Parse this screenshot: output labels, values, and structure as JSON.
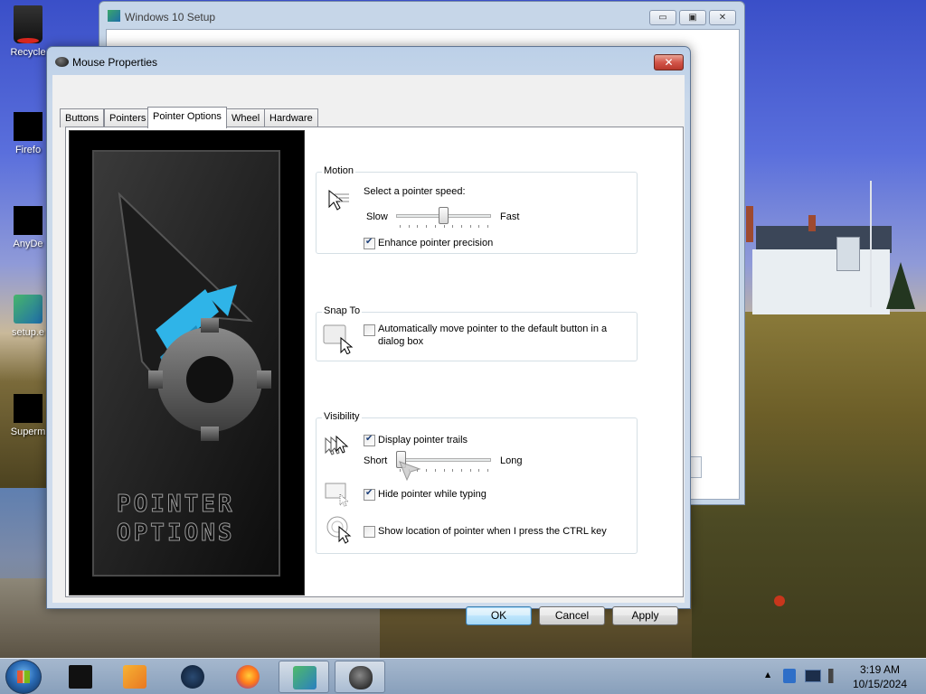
{
  "desktop": {
    "icons": [
      {
        "label": "Recycle"
      },
      {
        "label": "Firefo"
      },
      {
        "label": "AnyDe"
      },
      {
        "label": "setup.e"
      },
      {
        "label": "Superm"
      }
    ]
  },
  "background_window": {
    "title": "Windows 10 Setup",
    "minimize_glyph": "▭",
    "maximize_glyph": "▣",
    "close_glyph": "✕"
  },
  "dialog": {
    "title": "Mouse Properties",
    "close_glyph": "✕",
    "tabs": [
      {
        "label": "Buttons",
        "active": false
      },
      {
        "label": "Pointers",
        "active": false
      },
      {
        "label": "Pointer Options",
        "active": true
      },
      {
        "label": "Wheel",
        "active": false
      },
      {
        "label": "Hardware",
        "active": false
      }
    ],
    "art": {
      "line1": "POINTER",
      "line2": "OPTIONS"
    },
    "motion": {
      "title": "Motion",
      "speed_label": "Select a pointer speed:",
      "slow_label": "Slow",
      "fast_label": "Fast",
      "speed_position": 0.5,
      "enhance_label": "Enhance pointer precision",
      "enhance_checked": true
    },
    "snap_to": {
      "title": "Snap To",
      "auto_move_label_line1": "Automatically move pointer to the default button in a",
      "auto_move_label_line2": "dialog box",
      "auto_move_checked": false
    },
    "visibility": {
      "title": "Visibility",
      "trails_label": "Display pointer trails",
      "trails_checked": true,
      "short_label": "Short",
      "long_label": "Long",
      "trails_position": 0.0,
      "hide_typing_label": "Hide pointer while typing",
      "hide_typing_checked": true,
      "ctrl_location_label": "Show location of pointer when I press the CTRL key",
      "ctrl_location_checked": false
    },
    "buttons": {
      "ok": "OK",
      "cancel": "Cancel",
      "apply": "Apply"
    }
  },
  "taskbar": {
    "time": "3:19 AM",
    "date": "10/15/2024",
    "tray_arrow": "▲",
    "items": [
      {
        "name": "terminal"
      },
      {
        "name": "media-player"
      },
      {
        "name": "steam"
      },
      {
        "name": "firefox"
      },
      {
        "name": "setup"
      },
      {
        "name": "mouse-properties"
      }
    ]
  },
  "colors": {
    "dialog_frame": "#cfdcec",
    "close_button": "#d3564a",
    "default_button_border": "#3c7fb1",
    "art_accent": "#2fb4e8"
  }
}
